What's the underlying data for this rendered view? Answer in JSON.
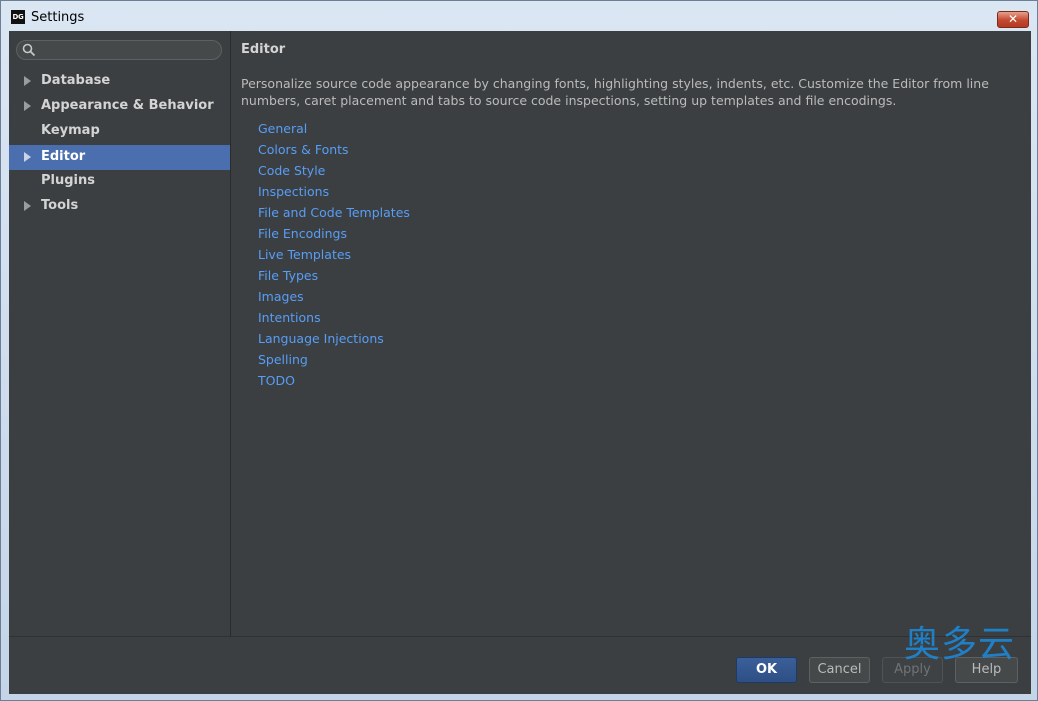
{
  "window": {
    "title": "Settings",
    "app_icon_text": "DG",
    "close_glyph": "✕"
  },
  "search": {
    "placeholder": "",
    "value": ""
  },
  "sidebar": {
    "items": [
      {
        "label": "Database",
        "has_arrow": true,
        "selected": false
      },
      {
        "label": "Appearance & Behavior",
        "has_arrow": true,
        "selected": false
      },
      {
        "label": "Keymap",
        "has_arrow": false,
        "selected": false
      },
      {
        "label": "Editor",
        "has_arrow": true,
        "selected": true
      },
      {
        "label": "Plugins",
        "has_arrow": false,
        "selected": false
      },
      {
        "label": "Tools",
        "has_arrow": true,
        "selected": false
      }
    ]
  },
  "main": {
    "title": "Editor",
    "description": "Personalize source code appearance by changing fonts, highlighting styles, indents, etc. Customize the Editor from line numbers, caret placement and tabs to source code inspections, setting up templates and file encodings.",
    "links": [
      "General",
      "Colors & Fonts",
      "Code Style",
      "Inspections",
      "File and Code Templates",
      "File Encodings",
      "Live Templates",
      "File Types",
      "Images",
      "Intentions",
      "Language Injections",
      "Spelling",
      "TODO"
    ]
  },
  "footer": {
    "ok_label": "OK",
    "cancel_label": "Cancel",
    "apply_label": "Apply",
    "help_label": "Help"
  },
  "watermark": {
    "text": "奥多云"
  },
  "colors": {
    "panel_bg": "#3c3f41",
    "selection": "#4b6eaf",
    "link": "#589df6"
  }
}
